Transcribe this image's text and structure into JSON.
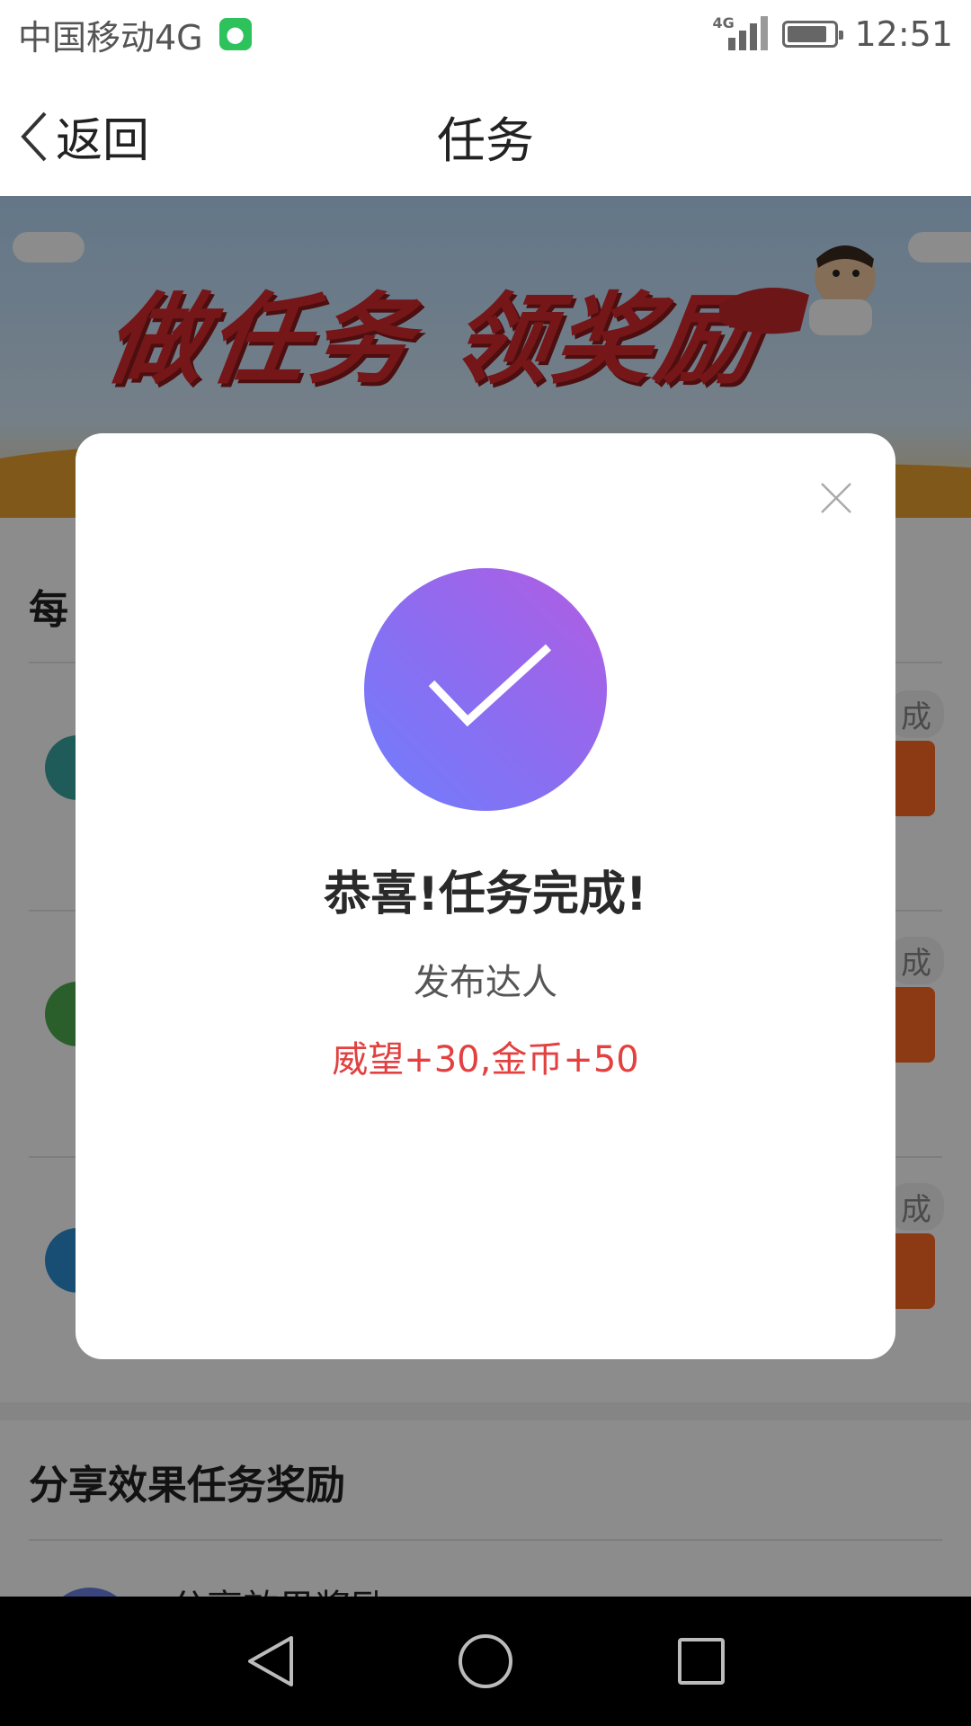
{
  "status_bar": {
    "carrier": "中国移动4G",
    "network_tag": "4G",
    "time": "12:51",
    "battery_level": 0.85
  },
  "nav": {
    "back_label": "返回",
    "title": "任务"
  },
  "banner": {
    "title": "做任务 领奖励"
  },
  "background": {
    "daily_section_title": "每",
    "task_badges": [
      "成",
      "成",
      "成"
    ],
    "share_section_title": "分享效果任务奖励",
    "share_item_label": "分享效果奖励"
  },
  "modal": {
    "title": "恭喜!任务完成!",
    "task_name": "发布达人",
    "reward": "威望+30,金币+50"
  },
  "colors": {
    "accent_orange": "#ff6a25",
    "reward_red": "#e34040",
    "gradient_start": "#b25de2",
    "gradient_end": "#6e7ffc"
  }
}
